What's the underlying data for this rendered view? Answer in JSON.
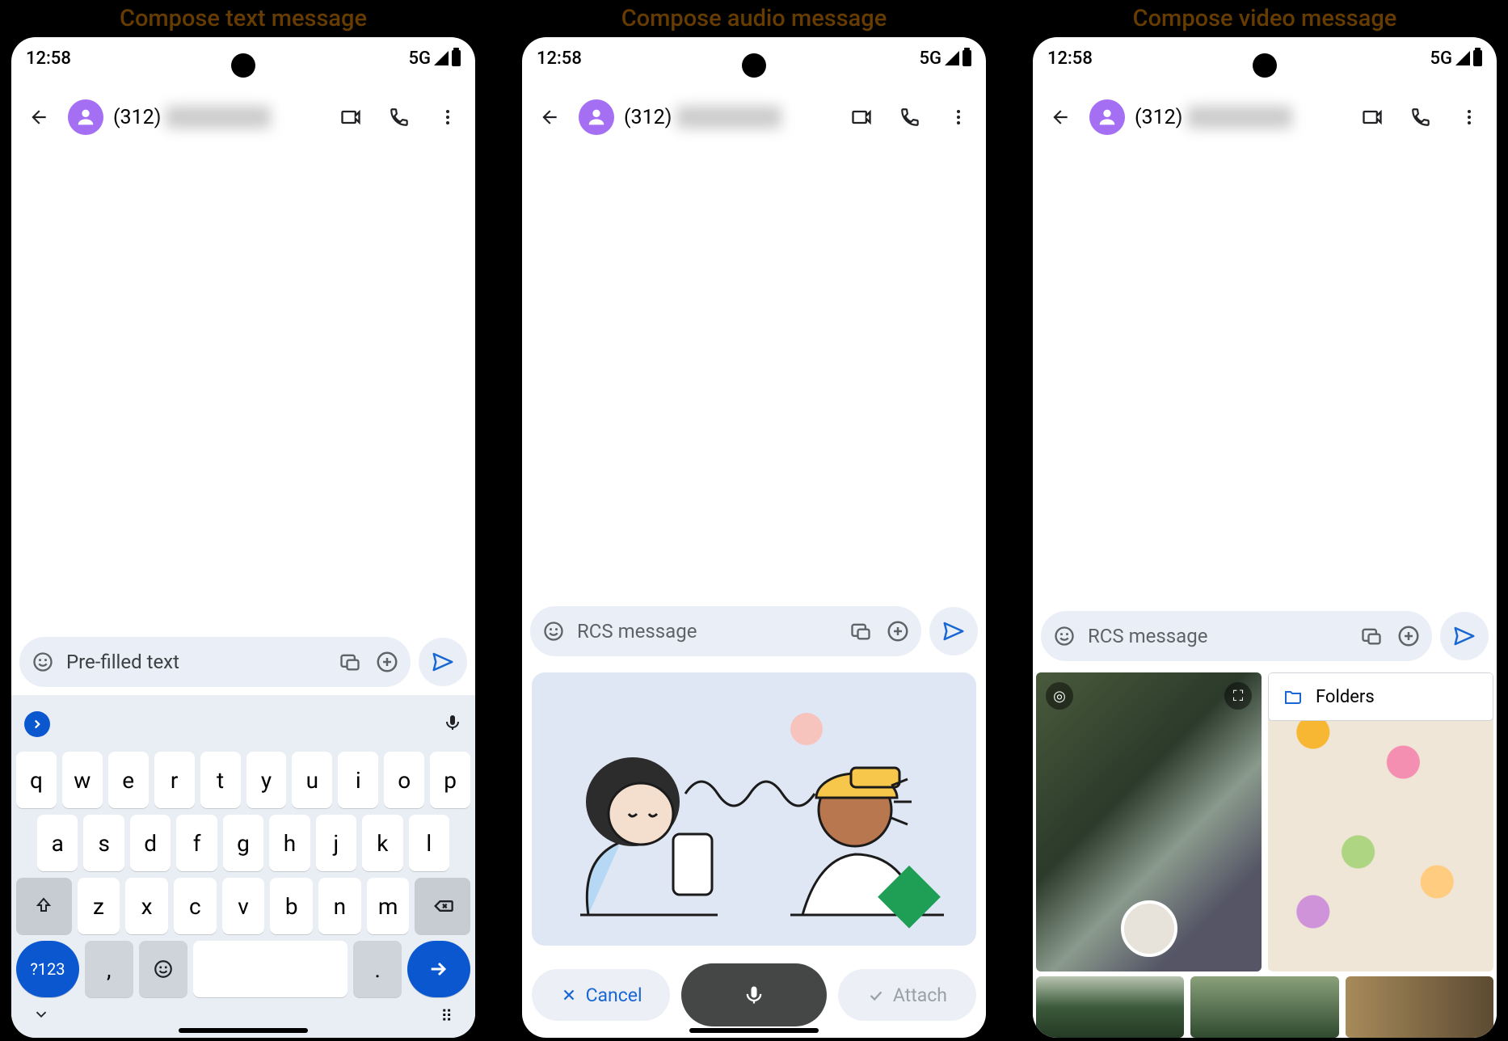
{
  "titles": {
    "text": "Compose text message",
    "audio": "Compose audio message",
    "video": "Compose video message"
  },
  "status": {
    "time": "12:58",
    "network": "5G"
  },
  "header": {
    "contact": "(312)"
  },
  "compose": {
    "prefilled": "Pre-filled text",
    "placeholder": "RCS message"
  },
  "keyboard": {
    "rows": [
      [
        "q",
        "w",
        "e",
        "r",
        "t",
        "y",
        "u",
        "i",
        "o",
        "p"
      ],
      [
        "a",
        "s",
        "d",
        "f",
        "g",
        "h",
        "j",
        "k",
        "l"
      ],
      [
        "z",
        "x",
        "c",
        "v",
        "b",
        "n",
        "m"
      ]
    ],
    "numKey": "?123",
    "comma": ",",
    "period": "."
  },
  "audio": {
    "cancel": "Cancel",
    "attach": "Attach"
  },
  "gallery": {
    "folders": "Folders"
  }
}
